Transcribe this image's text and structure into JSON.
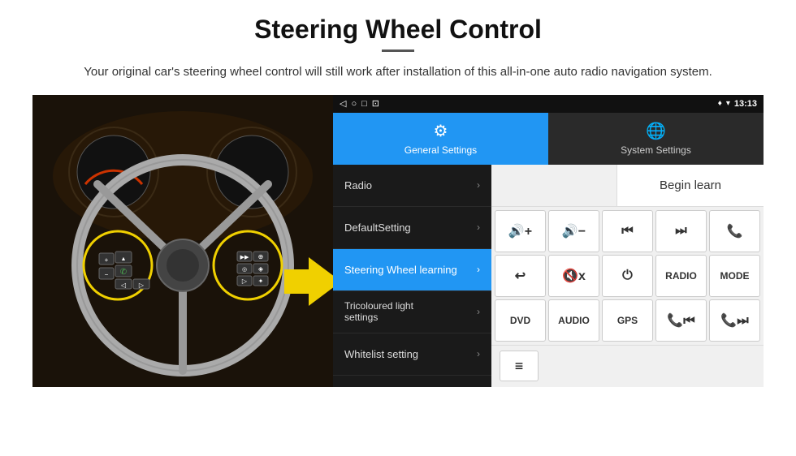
{
  "header": {
    "title": "Steering Wheel Control",
    "subtitle": "Your original car's steering wheel control will still work after installation of this all-in-one auto radio navigation system."
  },
  "status_bar": {
    "time": "13:13",
    "icons": [
      "◁",
      "○",
      "□",
      "⊡",
      "♦",
      "▾"
    ]
  },
  "tabs": {
    "general": "General Settings",
    "system": "System Settings"
  },
  "menu": {
    "items": [
      {
        "label": "Radio",
        "active": false
      },
      {
        "label": "DefaultSetting",
        "active": false
      },
      {
        "label": "Steering Wheel learning",
        "active": true
      },
      {
        "label": "Tricoloured light settings",
        "active": false
      },
      {
        "label": "Whitelist setting",
        "active": false
      }
    ]
  },
  "controls": {
    "begin_learn": "Begin learn",
    "row1": [
      "🔊+",
      "🔊−",
      "⏮",
      "⏭",
      "📞"
    ],
    "row2": [
      "↩",
      "🔇x",
      "⏻",
      "RADIO",
      "MODE"
    ],
    "row3": [
      "DVD",
      "AUDIO",
      "GPS",
      "📞⏮",
      "📞⏭"
    ],
    "whitelist_icon": "≡"
  }
}
